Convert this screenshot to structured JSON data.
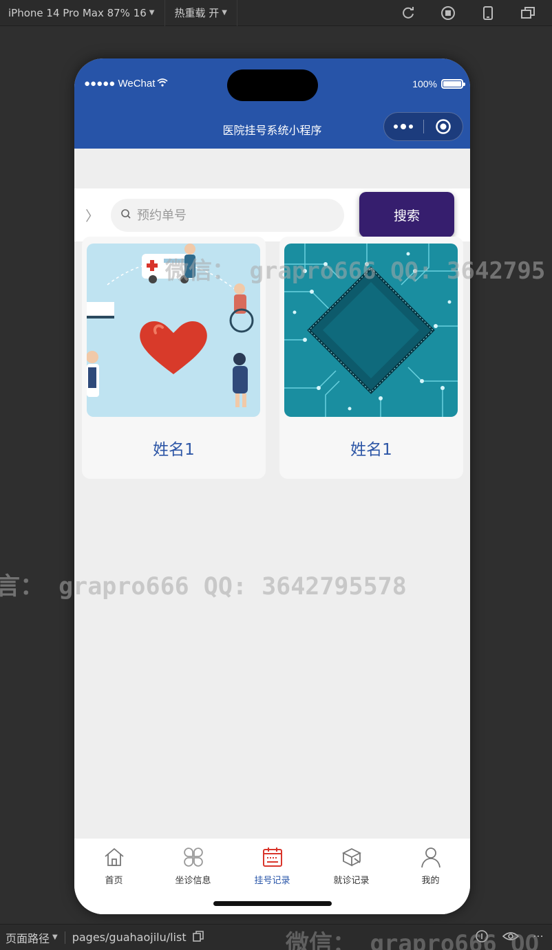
{
  "devtools": {
    "device": "iPhone 14 Pro Max 87% 16",
    "hotreload": "热重载 开"
  },
  "status_bar": {
    "carrier": "●●●●● WeChat",
    "battery": "100%"
  },
  "nav": {
    "title": "医院挂号系统小程序"
  },
  "search": {
    "placeholder": "预约单号",
    "button_label": "搜索"
  },
  "cards": [
    {
      "name": "姓名1"
    },
    {
      "name": "姓名1"
    }
  ],
  "tabs": [
    {
      "label": "首页",
      "icon": "home-icon"
    },
    {
      "label": "坐诊信息",
      "icon": "grid-icon"
    },
    {
      "label": "挂号记录",
      "icon": "calendar-icon",
      "active": true
    },
    {
      "label": "就诊记录",
      "icon": "box-icon"
    },
    {
      "label": "我的",
      "icon": "user-icon"
    }
  ],
  "footer": {
    "path_label": "页面路径",
    "path": "pages/guahaojilu/list"
  },
  "watermark": {
    "line1": "微信： grapro666 QQ: 3642795",
    "line2": "言： grapro666 QQ: 3642795578",
    "line3": "微信： grapro666 QQ"
  },
  "colors": {
    "header": "#2754a8",
    "search_button": "#361e6e",
    "active_tab": "#d9352b",
    "name_text": "#2d56a6"
  }
}
